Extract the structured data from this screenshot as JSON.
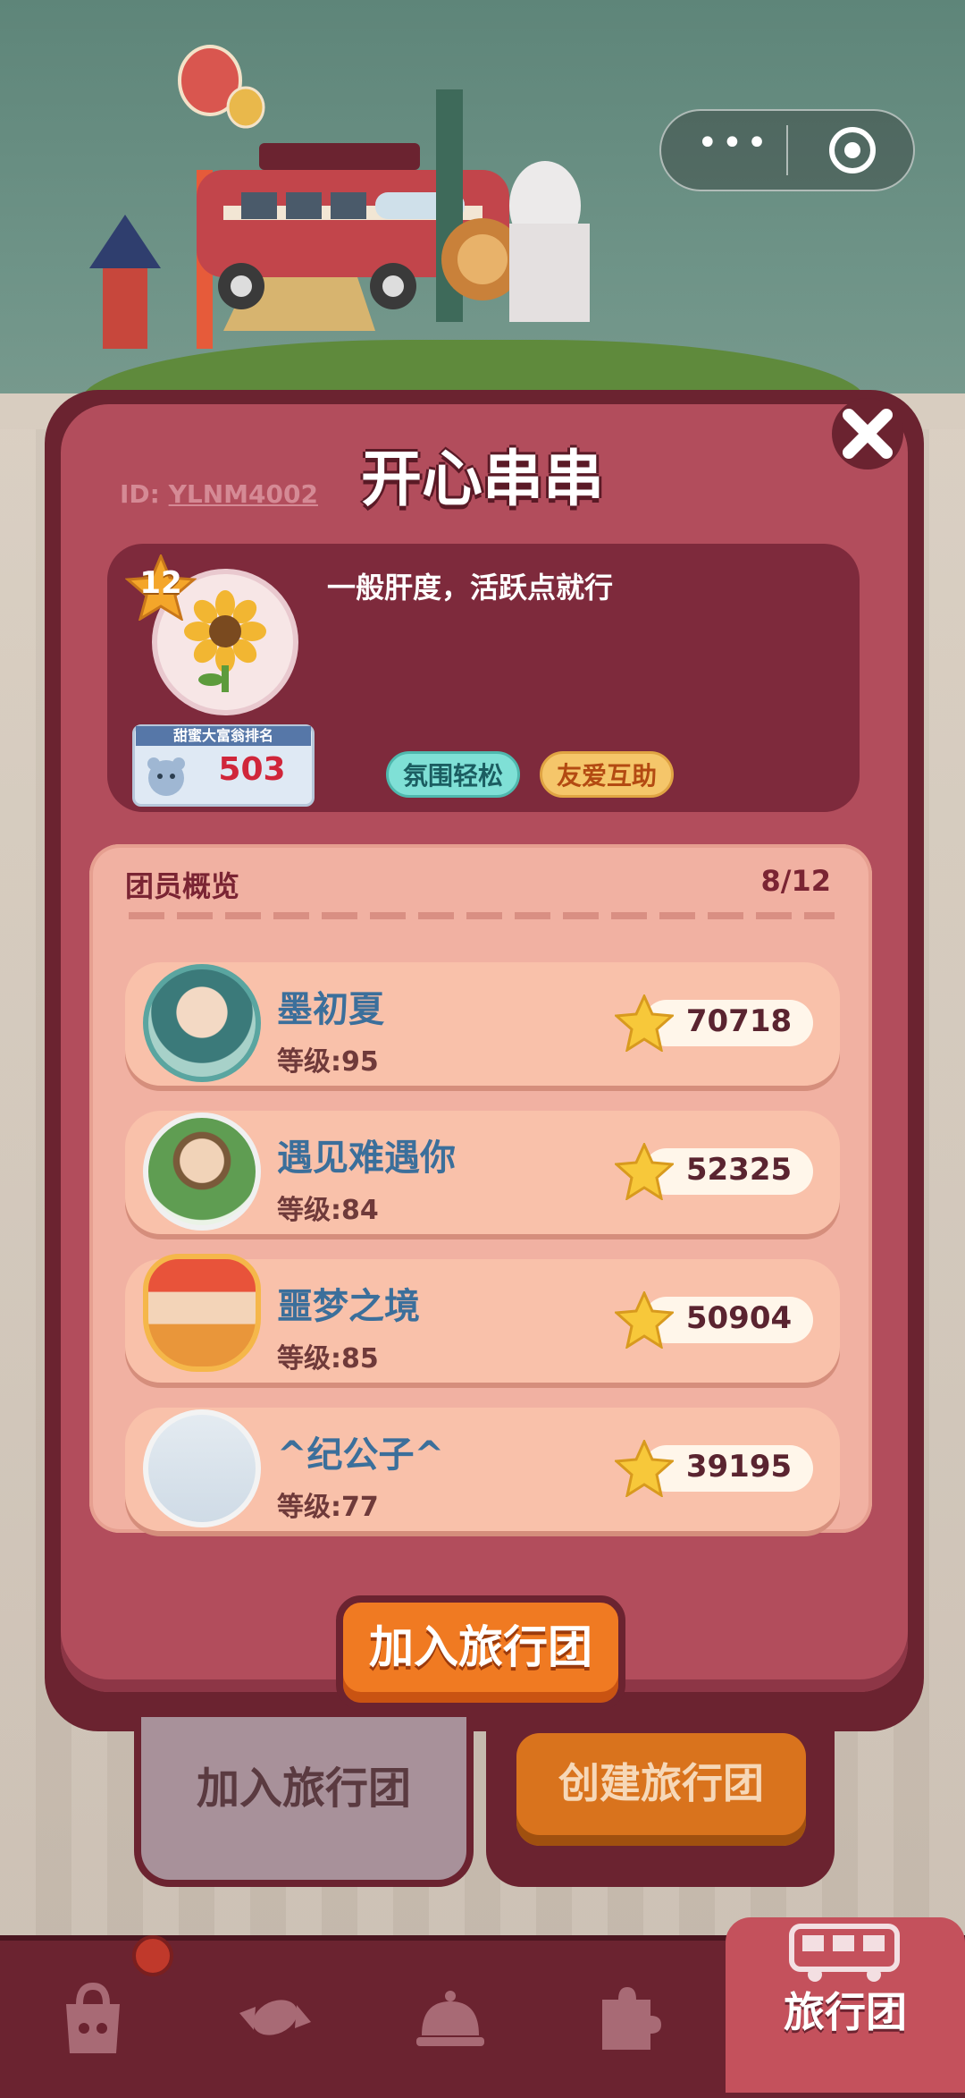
{
  "team": {
    "name": "开心串串",
    "id_label": "ID:",
    "id_value": "YLNM4002",
    "level": "12",
    "description": "一般肝度，活跃点就行",
    "rank_title": "甜蜜大富翁排名",
    "rank_value": "503",
    "tags": [
      "氛围轻松",
      "友爱互助"
    ]
  },
  "members": {
    "title": "团员概览",
    "count": "8/12",
    "list": [
      {
        "name": "墨初夏",
        "level": "等级:95",
        "score": "70718"
      },
      {
        "name": "遇见难遇你",
        "level": "等级:84",
        "score": "52325"
      },
      {
        "name": "噩梦之境",
        "level": "等级:85",
        "score": "50904"
      },
      {
        "name": "^纪公子^",
        "level": "等级:77",
        "score": "39195"
      }
    ]
  },
  "buttons": {
    "join_main": "加入旅行团",
    "tab_join": "加入旅行团",
    "tab_create": "创建旅行团"
  },
  "nav": {
    "active_label": "旅行团",
    "icons": [
      "shop-icon",
      "candy-icon",
      "service-bell-icon",
      "puzzle-icon",
      "bus-icon"
    ]
  },
  "colors": {
    "panel": "#b24d5c",
    "panel_border": "#6b2330",
    "accent_orange": "#f07a22",
    "name_blue": "#3b6f9b"
  }
}
